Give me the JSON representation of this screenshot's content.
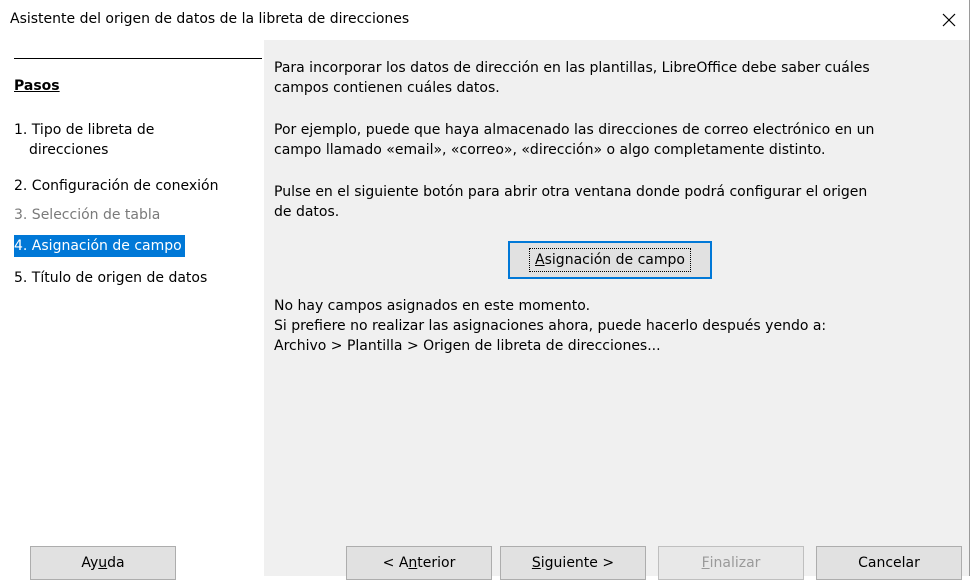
{
  "window": {
    "title": "Asistente del origen de datos de la libreta de direcciones"
  },
  "sidebar": {
    "heading": "Pasos",
    "steps": [
      {
        "label_line1": "1. Tipo de libreta de",
        "label_line2": "direcciones",
        "state": "normal"
      },
      {
        "label": "2. Configuración de conexión",
        "state": "normal"
      },
      {
        "label": "3. Selección de tabla",
        "state": "disabled"
      },
      {
        "label": "4. Asignación de campo",
        "state": "selected"
      },
      {
        "label": "5. Título de origen de datos",
        "state": "normal"
      }
    ]
  },
  "content": {
    "para1_line1": "Para incorporar los datos de dirección en las plantillas, LibreOffice debe saber cuáles",
    "para1_line2": "campos contienen cuáles datos.",
    "para2_line1": "Por ejemplo, puede que haya almacenado las direcciones de correo electrónico en un",
    "para2_line2": "campo llamado «email», «correo», «dirección» o algo completamente distinto.",
    "para3_line1": "Pulse en el siguiente botón para abrir otra ventana donde podrá configurar el origen",
    "para3_line2": "de datos.",
    "field_button": {
      "pre": "",
      "mnemonic": "A",
      "post": "signación de campo"
    },
    "status_line1": "No hay campos asignados en este momento.",
    "status_line2": "Si prefiere no realizar las asignaciones ahora, puede hacerlo después yendo a:",
    "status_line3": "Archivo > Plantilla > Origen de libreta de direcciones..."
  },
  "buttons": {
    "help": {
      "pre": "Ay",
      "mnemonic": "u",
      "post": "da"
    },
    "back": {
      "pre": "< A",
      "mnemonic": "n",
      "post": "terior"
    },
    "next": {
      "pre": "",
      "mnemonic": "S",
      "post": "iguiente >"
    },
    "finish": {
      "pre": "",
      "mnemonic": "F",
      "post": "inalizar"
    },
    "cancel": {
      "label": "Cancelar"
    }
  },
  "colors": {
    "accent": "#0078d7",
    "panel": "#f0f0f0",
    "button": "#e1e1e1"
  },
  "icons": {
    "close": "close-icon"
  }
}
